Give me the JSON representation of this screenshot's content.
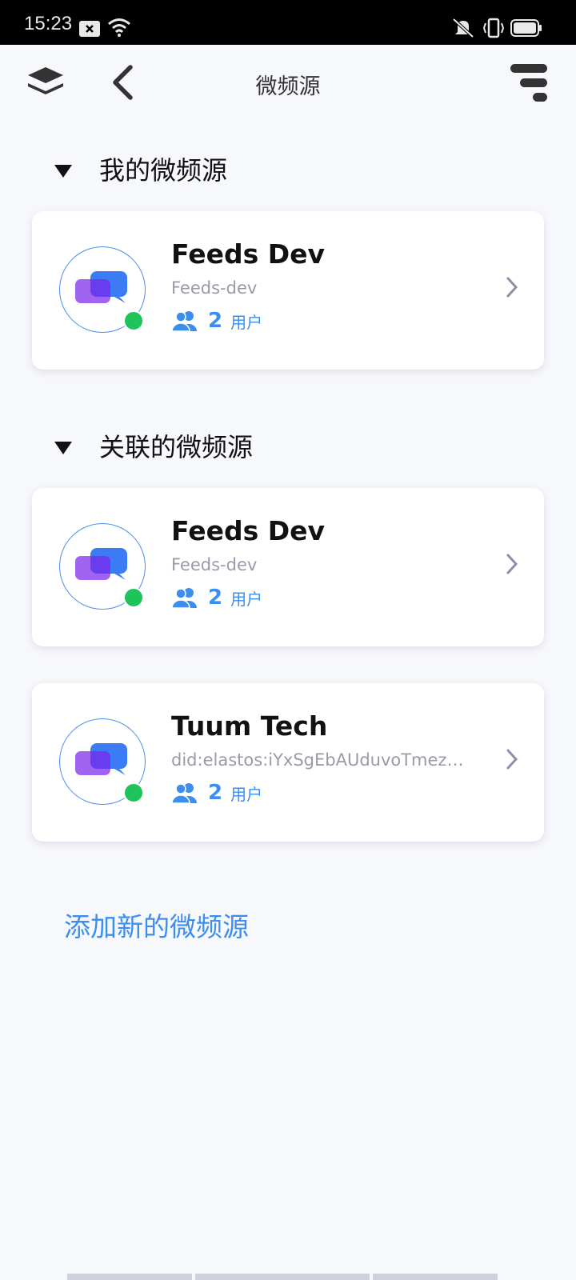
{
  "status_bar": {
    "time": "15:23"
  },
  "header": {
    "title": "微频源"
  },
  "sections": [
    {
      "title": "我的微频源",
      "feeds": [
        {
          "name": "Feeds Dev",
          "id": "Feeds-dev",
          "user_count": "2",
          "user_label": "用户"
        }
      ]
    },
    {
      "title": "关联的微频源",
      "feeds": [
        {
          "name": "Feeds Dev",
          "id": "Feeds-dev",
          "user_count": "2",
          "user_label": "用户"
        },
        {
          "name": "Tuum Tech",
          "id": "did:elastos:iYxSgEbAUduvoTmezqjsvN4T8q7mj9Y6qU",
          "user_count": "2",
          "user_label": "用户"
        }
      ]
    }
  ],
  "add_feed_label": "添加新的微频源",
  "colors": {
    "accent": "#3b8ef0",
    "online": "#1ec45a",
    "background": "#f7f8fc"
  },
  "icons": [
    "layers-icon",
    "back-arrow-icon",
    "menu-icon",
    "chevron-right-icon",
    "users-icon",
    "chat-bubbles-icon"
  ]
}
